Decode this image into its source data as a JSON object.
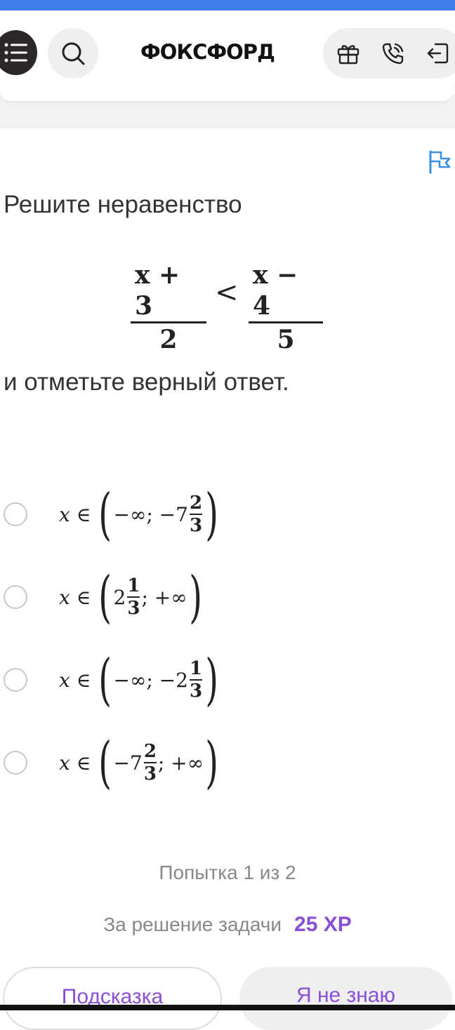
{
  "header": {
    "logo": "ФОКСФОРД",
    "icons": [
      "menu-icon",
      "search-icon",
      "gift-icon",
      "phone-icon",
      "logout-icon"
    ],
    "accent_strip_color": "#3f7ee8"
  },
  "task": {
    "prompt_start": "Решите неравенство",
    "inequality": {
      "left_num": "x + 3",
      "left_den": "2",
      "relation": "<",
      "right_num": "x − 4",
      "right_den": "5"
    },
    "prompt_end": "и отметьте верный ответ.",
    "flag_icon": "report-flag-icon"
  },
  "options": [
    {
      "prefix": "x ∈",
      "open": "(",
      "before": "−∞; −7",
      "frac_num": "2",
      "frac_den": "3",
      "after": "",
      "close": ")"
    },
    {
      "prefix": "x ∈",
      "open": "(",
      "before": "2",
      "frac_num": "1",
      "frac_den": "3",
      "after": "; +∞",
      "close": ")"
    },
    {
      "prefix": "x ∈",
      "open": "(",
      "before": "−∞; −2",
      "frac_num": "1",
      "frac_den": "3",
      "after": "",
      "close": ")"
    },
    {
      "prefix": "x ∈",
      "open": "(",
      "before": "−7",
      "frac_num": "2",
      "frac_den": "3",
      "after": "; +∞",
      "close": ")"
    }
  ],
  "footer": {
    "attempt": "Попытка 1 из 2",
    "reward_label": "За решение задачи",
    "reward_value": "25 XP",
    "hint_label": "Подсказка",
    "dont_know_label": "Я не знаю"
  },
  "colors": {
    "accent": "#8a4fd6",
    "flag": "#3b8fe0"
  }
}
